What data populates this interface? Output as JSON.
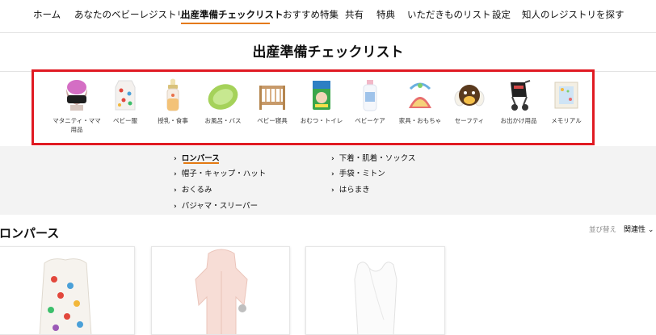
{
  "nav": {
    "items": [
      {
        "label": "ホーム"
      },
      {
        "label": "あなたのベビーレジストリ"
      },
      {
        "label": "出産準備チェックリスト"
      },
      {
        "label": "おすすめ特集"
      },
      {
        "label": "共有"
      },
      {
        "label": "特典"
      },
      {
        "label": "いただきものリスト"
      },
      {
        "label": "設定"
      },
      {
        "label": "知人のレジストリを探す"
      }
    ],
    "active_index": 2
  },
  "page": {
    "title": "出産準備チェックリスト"
  },
  "categories": [
    {
      "label": "マタニティ・ママ用品",
      "icon": "maternity-belt-icon"
    },
    {
      "label": "ベビー服",
      "icon": "baby-clothes-icon"
    },
    {
      "label": "授乳・食事",
      "icon": "baby-bottle-icon"
    },
    {
      "label": "お風呂・バス",
      "icon": "baby-bathtub-icon"
    },
    {
      "label": "ベビー寝具",
      "icon": "baby-crib-icon"
    },
    {
      "label": "おむつ・トイレ",
      "icon": "diaper-pack-icon"
    },
    {
      "label": "ベビーケア",
      "icon": "lotion-bottle-icon"
    },
    {
      "label": "家具・おもちゃ",
      "icon": "baby-bouncer-icon"
    },
    {
      "label": "セーフティ",
      "icon": "safety-cushion-icon"
    },
    {
      "label": "お出かけ用品",
      "icon": "stroller-icon"
    },
    {
      "label": "メモリアル",
      "icon": "memorial-frame-icon"
    }
  ],
  "subcategories": {
    "left": [
      "ロンパース",
      "帽子・キャップ・ハット",
      "おくるみ",
      "パジャマ・スリーパー"
    ],
    "right": [
      "下着・肌着・ソックス",
      "手袋・ミトン",
      "はらまき"
    ],
    "active": "ロンパース"
  },
  "section": {
    "title": "ロンパース"
  },
  "sort": {
    "label": "並び替え",
    "value": "関連性"
  },
  "products": [
    {
      "image": "mushroom-print-sleeper"
    },
    {
      "image": "pink-hooded-romper"
    },
    {
      "image": "white-sleeveless-romper"
    }
  ],
  "colors": {
    "accent": "#e47911",
    "highlight": "#e01a22"
  }
}
